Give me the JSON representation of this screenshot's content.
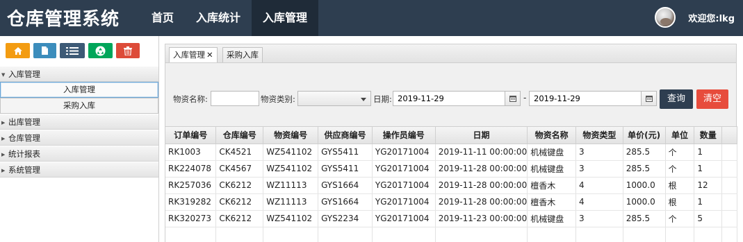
{
  "header": {
    "title": "仓库管理系统",
    "nav": [
      "首页",
      "入库统计",
      "入库管理"
    ],
    "active_nav_index": 2,
    "welcome": "欢迎您:lkg"
  },
  "sidebar": {
    "toolbar_icons": [
      "home-icon",
      "file-icon",
      "list-icon",
      "recycle-icon",
      "trash-icon"
    ],
    "menu": {
      "inbound": {
        "label": "入库管理",
        "items": [
          "入库管理",
          "采购入库"
        ],
        "selected": "入库管理"
      },
      "outbound": "出库管理",
      "warehouse": "仓库管理",
      "reports": "统计报表",
      "system": "系统管理"
    }
  },
  "tabs": [
    {
      "label": "入库管理",
      "closable": true,
      "active": true
    },
    {
      "label": "采购入库",
      "closable": false,
      "active": false
    }
  ],
  "filter": {
    "name_label": "物资名称:",
    "name_value": "",
    "type_label": "物资类别:",
    "type_value": "",
    "date_label": "日期:",
    "date_from": "2019-11-29",
    "date_separator": "-",
    "date_to": "2019-11-29",
    "query_button": "查询",
    "clear_button": "清空"
  },
  "table": {
    "columns": [
      "订单编号",
      "仓库编号",
      "物资编号",
      "供应商编号",
      "操作员编号",
      "日期",
      "物资名称",
      "物资类型",
      "单价(元)",
      "单位",
      "数量"
    ],
    "rows": [
      [
        "RK1003",
        "CK4521",
        "WZ541102",
        "GYS5411",
        "YG20171004",
        "2019-11-11 00:00:00",
        "机械键盘",
        "3",
        "285.5",
        "个",
        "1"
      ],
      [
        "RK224078",
        "CK4567",
        "WZ541102",
        "GYS5411",
        "YG20171004",
        "2019-11-28 00:00:00",
        "机械键盘",
        "3",
        "285.5",
        "个",
        "1"
      ],
      [
        "RK257036",
        "CK6212",
        "WZ11113",
        "GYS1664",
        "YG20171004",
        "2019-11-28 00:00:00",
        "檀香木",
        "4",
        "1000.0",
        "根",
        "12"
      ],
      [
        "RK319282",
        "CK6212",
        "WZ11113",
        "GYS1664",
        "YG20171004",
        "2019-11-28 00:00:00",
        "檀香木",
        "4",
        "1000.0",
        "根",
        "1"
      ],
      [
        "RK320273",
        "CK6212",
        "WZ541102",
        "GYS2234",
        "YG20171004",
        "2019-11-23 00:00:00",
        "机械键盘",
        "3",
        "285.5",
        "个",
        "5"
      ]
    ]
  },
  "colors": {
    "header_bg": "#2e3e50",
    "home": "#f39c12",
    "file": "#3c8dbc",
    "list": "#3d5a76",
    "recycle": "#00a65a",
    "trash": "#dd4b39",
    "query": "#2e3e50",
    "clear": "#e74c3c"
  }
}
